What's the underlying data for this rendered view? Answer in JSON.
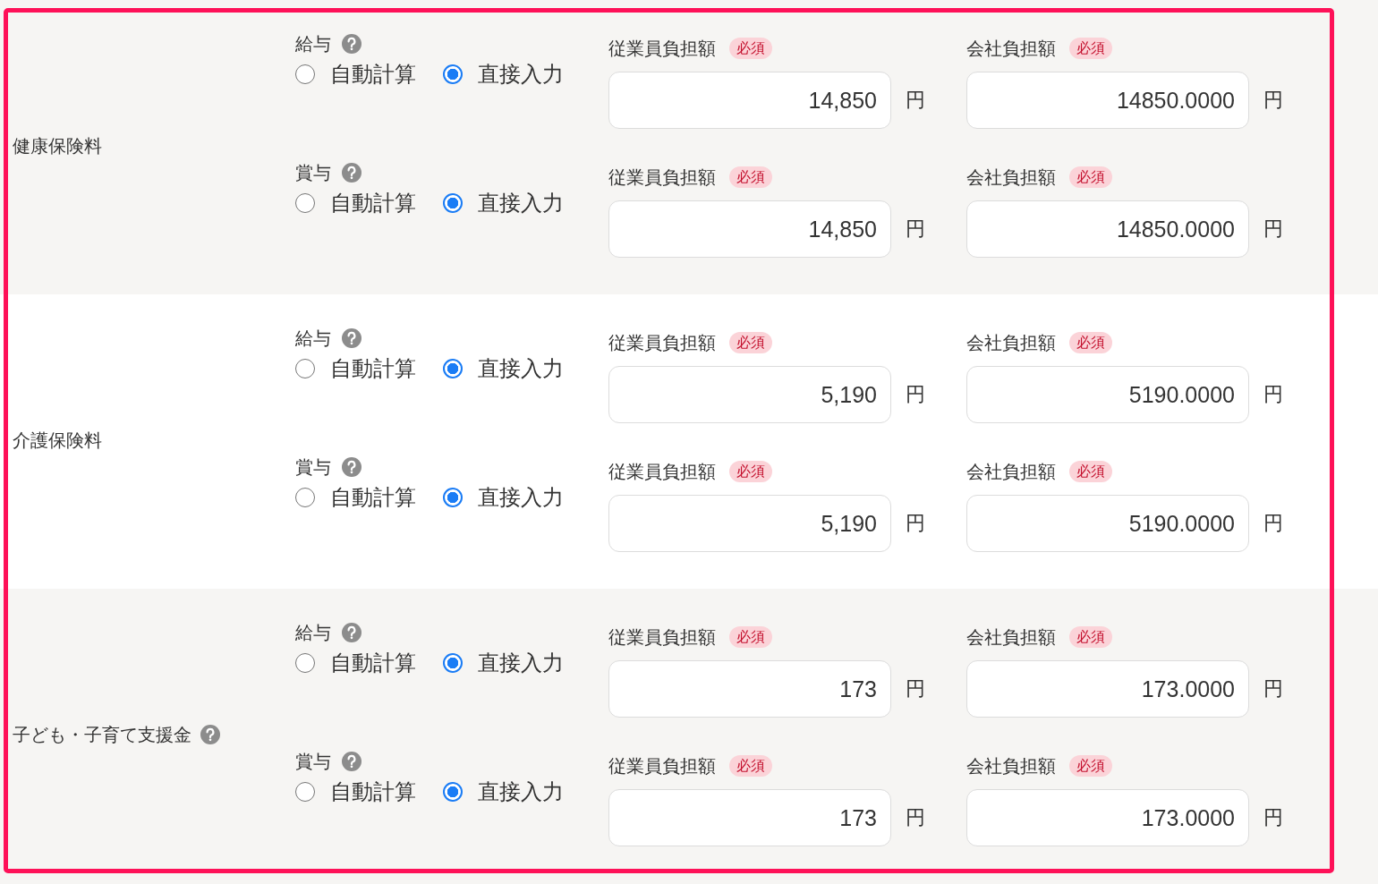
{
  "sections": [
    {
      "label": "健康保険料",
      "help": false,
      "rows": [
        {
          "label": "給与",
          "help": true,
          "options": [
            {
              "label": "自動計算",
              "selected": false
            },
            {
              "label": "直接入力",
              "selected": true
            }
          ],
          "amounts": [
            {
              "label": "従業員負担額",
              "badge": "必須",
              "value": "14,850",
              "unit": "円"
            },
            {
              "label": "会社負担額",
              "badge": "必須",
              "value": "14850.0000",
              "unit": "円"
            }
          ]
        },
        {
          "label": "賞与",
          "help": true,
          "options": [
            {
              "label": "自動計算",
              "selected": false
            },
            {
              "label": "直接入力",
              "selected": true
            }
          ],
          "amounts": [
            {
              "label": "従業員負担額",
              "badge": "必須",
              "value": "14,850",
              "unit": "円"
            },
            {
              "label": "会社負担額",
              "badge": "必須",
              "value": "14850.0000",
              "unit": "円"
            }
          ]
        }
      ]
    },
    {
      "label": "介護保険料",
      "help": false,
      "rows": [
        {
          "label": "給与",
          "help": true,
          "options": [
            {
              "label": "自動計算",
              "selected": false
            },
            {
              "label": "直接入力",
              "selected": true
            }
          ],
          "amounts": [
            {
              "label": "従業員負担額",
              "badge": "必須",
              "value": "5,190",
              "unit": "円"
            },
            {
              "label": "会社負担額",
              "badge": "必須",
              "value": "5190.0000",
              "unit": "円"
            }
          ]
        },
        {
          "label": "賞与",
          "help": true,
          "options": [
            {
              "label": "自動計算",
              "selected": false
            },
            {
              "label": "直接入力",
              "selected": true
            }
          ],
          "amounts": [
            {
              "label": "従業員負担額",
              "badge": "必須",
              "value": "5,190",
              "unit": "円"
            },
            {
              "label": "会社負担額",
              "badge": "必須",
              "value": "5190.0000",
              "unit": "円"
            }
          ]
        }
      ]
    },
    {
      "label": "子ども・子育て支援金",
      "help": true,
      "rows": [
        {
          "label": "給与",
          "help": true,
          "options": [
            {
              "label": "自動計算",
              "selected": false
            },
            {
              "label": "直接入力",
              "selected": true
            }
          ],
          "amounts": [
            {
              "label": "従業員負担額",
              "badge": "必須",
              "value": "173",
              "unit": "円"
            },
            {
              "label": "会社負担額",
              "badge": "必須",
              "value": "173.0000",
              "unit": "円"
            }
          ]
        },
        {
          "label": "賞与",
          "help": true,
          "options": [
            {
              "label": "自動計算",
              "selected": false
            },
            {
              "label": "直接入力",
              "selected": true
            }
          ],
          "amounts": [
            {
              "label": "従業員負担額",
              "badge": "必須",
              "value": "173",
              "unit": "円"
            },
            {
              "label": "会社負担額",
              "badge": "必須",
              "value": "173.0000",
              "unit": "円"
            }
          ]
        }
      ]
    }
  ]
}
